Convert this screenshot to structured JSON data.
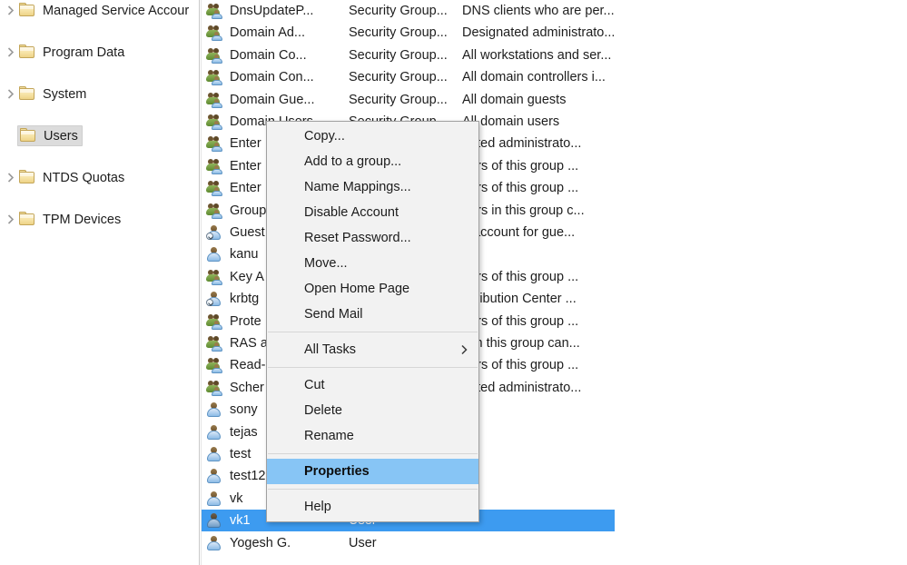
{
  "tree": {
    "items": [
      {
        "label": "Managed Service Accour",
        "expandable": true,
        "selected": false,
        "icon": "folder-icon"
      },
      {
        "label": "Program Data",
        "expandable": true,
        "selected": false,
        "icon": "folder-icon"
      },
      {
        "label": "System",
        "expandable": true,
        "selected": false,
        "icon": "folder-icon"
      },
      {
        "label": "Users",
        "expandable": false,
        "selected": true,
        "icon": "folder-icon"
      },
      {
        "label": "NTDS Quotas",
        "expandable": true,
        "selected": false,
        "icon": "folder-icon"
      },
      {
        "label": "TPM Devices",
        "expandable": true,
        "selected": false,
        "icon": "folder-icon"
      }
    ]
  },
  "list": {
    "rows": [
      {
        "name": "DnsUpdateP...",
        "type": "Security Group...",
        "description": "DNS clients who are per...",
        "icon": "group-icon",
        "selected": false
      },
      {
        "name": "Domain Ad...",
        "type": "Security Group...",
        "description": "Designated administrato...",
        "icon": "group-icon",
        "selected": false
      },
      {
        "name": "Domain Co...",
        "type": "Security Group...",
        "description": "All workstations and ser...",
        "icon": "group-icon",
        "selected": false
      },
      {
        "name": "Domain Con...",
        "type": "Security Group...",
        "description": "All domain controllers i...",
        "icon": "group-icon",
        "selected": false
      },
      {
        "name": "Domain Gue...",
        "type": "Security Group...",
        "description": "All domain guests",
        "icon": "group-icon",
        "selected": false
      },
      {
        "name": "Domain Users",
        "type": "Security Group...",
        "description": "All domain users",
        "icon": "group-icon",
        "selected": false
      },
      {
        "name": "Enter",
        "type": "",
        "description": "nated administrato...",
        "icon": "group-icon",
        "selected": false
      },
      {
        "name": "Enter",
        "type": "",
        "description": "bers of this group ...",
        "icon": "group-icon",
        "selected": false
      },
      {
        "name": "Enter",
        "type": "",
        "description": "bers of this group ...",
        "icon": "group-icon",
        "selected": false
      },
      {
        "name": "Group",
        "type": "",
        "description": "bers in this group c...",
        "icon": "group-icon",
        "selected": false
      },
      {
        "name": "Guest",
        "type": "",
        "description": "n account for gue...",
        "icon": "user-builtin-icon",
        "selected": false
      },
      {
        "name": "kanu",
        "type": "",
        "description": "",
        "icon": "user-icon",
        "selected": false
      },
      {
        "name": "Key A",
        "type": "",
        "description": "bers of this group ...",
        "icon": "group-icon",
        "selected": false
      },
      {
        "name": "krbtg",
        "type": "",
        "description": "istribution Center ...",
        "icon": "user-builtin-icon",
        "selected": false
      },
      {
        "name": "Prote",
        "type": "",
        "description": "bers of this group ...",
        "icon": "group-icon",
        "selected": false
      },
      {
        "name": "RAS a",
        "type": "",
        "description": "s in this group can...",
        "icon": "group-icon",
        "selected": false
      },
      {
        "name": "Read-",
        "type": "",
        "description": "bers of this group ...",
        "icon": "group-icon",
        "selected": false
      },
      {
        "name": "Scher",
        "type": "",
        "description": "nated administrato...",
        "icon": "group-icon",
        "selected": false
      },
      {
        "name": "sony",
        "type": "",
        "description": "",
        "icon": "user-icon",
        "selected": false
      },
      {
        "name": "tejas",
        "type": "",
        "description": "",
        "icon": "user-icon",
        "selected": false
      },
      {
        "name": "test",
        "type": "",
        "description": "",
        "icon": "user-icon",
        "selected": false
      },
      {
        "name": "test12",
        "type": "",
        "description": "",
        "icon": "user-icon",
        "selected": false
      },
      {
        "name": "vk",
        "type": "",
        "description": "",
        "icon": "user-icon",
        "selected": false
      },
      {
        "name": "vk1",
        "type": "User",
        "description": "",
        "icon": "user-icon",
        "selected": true
      },
      {
        "name": "Yogesh G.",
        "type": "User",
        "description": "",
        "icon": "user-icon",
        "selected": false
      }
    ]
  },
  "context_menu": {
    "items": [
      {
        "label": "Copy...",
        "type": "item",
        "highlight": false
      },
      {
        "label": "Add to a group...",
        "type": "item",
        "highlight": false
      },
      {
        "label": "Name Mappings...",
        "type": "item",
        "highlight": false
      },
      {
        "label": "Disable Account",
        "type": "item",
        "highlight": false
      },
      {
        "label": "Reset Password...",
        "type": "item",
        "highlight": false
      },
      {
        "label": "Move...",
        "type": "item",
        "highlight": false
      },
      {
        "label": "Open Home Page",
        "type": "item",
        "highlight": false
      },
      {
        "label": "Send Mail",
        "type": "item",
        "highlight": false
      },
      {
        "label": "",
        "type": "separator",
        "highlight": false
      },
      {
        "label": "All Tasks",
        "type": "submenu",
        "highlight": false
      },
      {
        "label": "",
        "type": "separator",
        "highlight": false
      },
      {
        "label": "Cut",
        "type": "item",
        "highlight": false
      },
      {
        "label": "Delete",
        "type": "item",
        "highlight": false
      },
      {
        "label": "Rename",
        "type": "item",
        "highlight": false
      },
      {
        "label": "",
        "type": "separator",
        "highlight": false
      },
      {
        "label": "Properties",
        "type": "item",
        "highlight": true
      },
      {
        "label": "",
        "type": "separator",
        "highlight": false
      },
      {
        "label": "Help",
        "type": "item",
        "highlight": false
      }
    ]
  },
  "colors": {
    "selection_blue": "#3d9bf0",
    "menu_highlight_blue": "#87c5f5",
    "menu_background": "#f2f2f2",
    "tree_selection_gray": "#dcdcdc"
  }
}
